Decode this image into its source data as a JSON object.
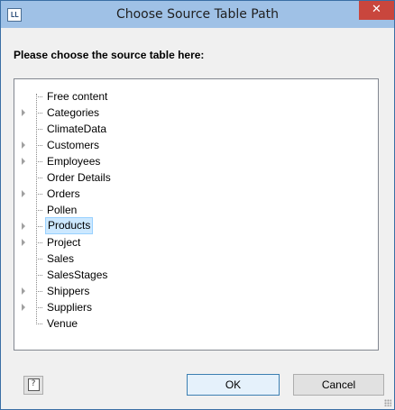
{
  "window": {
    "title": "Choose Source Table Path",
    "app_icon_text": "LL",
    "close_symbol": "✕"
  },
  "prompt": "Please choose the source table here:",
  "tree": {
    "items": [
      {
        "label": "Free content",
        "expandable": false,
        "selected": false
      },
      {
        "label": "Categories",
        "expandable": true,
        "selected": false
      },
      {
        "label": "ClimateData",
        "expandable": false,
        "selected": false
      },
      {
        "label": "Customers",
        "expandable": true,
        "selected": false
      },
      {
        "label": "Employees",
        "expandable": true,
        "selected": false
      },
      {
        "label": "Order Details",
        "expandable": false,
        "selected": false
      },
      {
        "label": "Orders",
        "expandable": true,
        "selected": false
      },
      {
        "label": "Pollen",
        "expandable": false,
        "selected": false
      },
      {
        "label": "Products",
        "expandable": true,
        "selected": true
      },
      {
        "label": "Project",
        "expandable": true,
        "selected": false
      },
      {
        "label": "Sales",
        "expandable": false,
        "selected": false
      },
      {
        "label": "SalesStages",
        "expandable": false,
        "selected": false
      },
      {
        "label": "Shippers",
        "expandable": true,
        "selected": false
      },
      {
        "label": "Suppliers",
        "expandable": true,
        "selected": false
      },
      {
        "label": "Venue",
        "expandable": false,
        "selected": false
      }
    ]
  },
  "buttons": {
    "help_symbol": "?",
    "ok_label": "OK",
    "cancel_label": "Cancel"
  },
  "colors": {
    "titlebar": "#9fc1e6",
    "close": "#c9463d",
    "selection": "#cce8ff"
  }
}
